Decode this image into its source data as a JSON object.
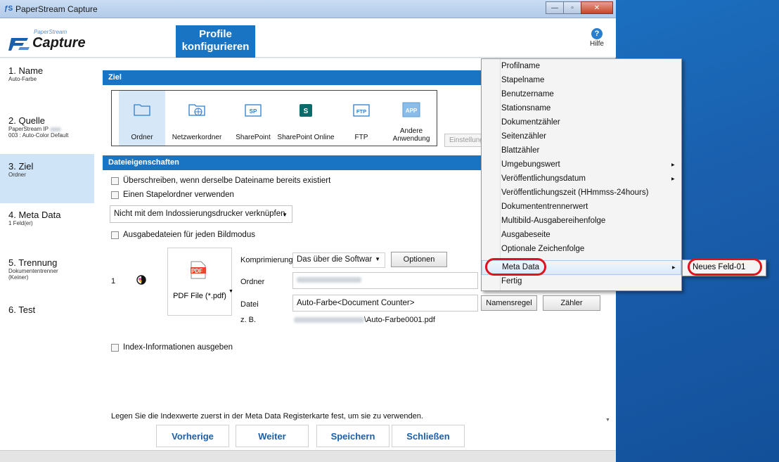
{
  "window": {
    "title": "PaperStream Capture",
    "controls": {
      "minimize": "—",
      "maximize": "▫",
      "close": "✕"
    }
  },
  "header": {
    "logo_small": "PaperStream",
    "logo_big": "Capture",
    "profile_title_line1": "Profile",
    "profile_title_line2": "konfigurieren",
    "help_label": "Hilfe",
    "help_glyph": "?"
  },
  "nav": {
    "items": [
      {
        "label": "1. Name",
        "sub": "Auto-Farbe"
      },
      {
        "label": "2. Quelle",
        "sub": "PaperStream IP",
        "sub2": "003 : Auto-Color Default"
      },
      {
        "label": "3. Ziel",
        "sub": "Ordner"
      },
      {
        "label": "4. Meta Data",
        "sub": "1 Feld(er)"
      },
      {
        "label": "5. Trennung",
        "sub": "Dokumententrenner",
        "sub2": "(Keiner)"
      },
      {
        "label": "6. Test",
        "sub": ""
      }
    ]
  },
  "ziel": {
    "section_title": "Ziel",
    "destinations": [
      {
        "label": "Ordner",
        "icon": "folder-icon"
      },
      {
        "label": "Netzwerkordner",
        "icon": "network-folder-icon"
      },
      {
        "label": "SharePoint",
        "icon": "sharepoint-icon"
      },
      {
        "label": "SharePoint Online",
        "icon": "sharepoint-online-icon"
      },
      {
        "label": "FTP",
        "icon": "ftp-icon"
      },
      {
        "label": "Andere Anwendung",
        "icon": "app-icon"
      }
    ],
    "settings_button": "Einstellungen"
  },
  "file_props": {
    "section_title": "Dateieigenschaften",
    "overwrite": "Überschreiben, wenn derselbe Dateiname bereits existiert",
    "batch_folder": "Einen Stapelordner verwenden",
    "imprinter_combo": "Nicht mit dem Indossierungsdrucker verknüpfen",
    "per_mode": "Ausgabedateien für jeden Bildmodus",
    "row_index": "1",
    "format_label": "PDF File (*.pdf)",
    "pdf_badge": "PDF",
    "compression_label": "Komprimierung",
    "compression_value": "Das über die Software",
    "options_button": "Optionen",
    "folder_label": "Ordner",
    "file_label": "Datei",
    "file_value": "Auto-Farbe<Document Counter>",
    "naming_button": "Namensregel",
    "counter_button": "Zähler",
    "example_label": "z. B.",
    "example_suffix": "\\Auto-Farbe0001.pdf",
    "index_info": "Index-Informationen ausgeben",
    "footer_note": "Legen Sie die Indexwerte zuerst in der Meta Data Registerkarte fest, um sie zu verwenden."
  },
  "buttons": {
    "previous": "Vorherige",
    "next": "Weiter",
    "save": "Speichern",
    "close": "Schließen"
  },
  "context_menu": {
    "items": [
      "Profilname",
      "Stapelname",
      "Benutzername",
      "Stationsname",
      "Dokumentzähler",
      "Seitenzähler",
      "Blattzähler",
      "Umgebungswert",
      "Veröffentlichungsdatum",
      "Veröffentlichungszeit (HHmmss-24hours)",
      "Dokumententrennerwert",
      "Multibild-Ausgabereihenfolge",
      "Ausgabeseite",
      "Optionale Zeichenfolge",
      "Meta Data",
      "Fertig"
    ],
    "submenu_item": "Neues Feld-01"
  },
  "colors": {
    "accent": "#1a74c4",
    "highlight_ring": "#e0121b",
    "selected_bg": "#d0e4f7"
  }
}
